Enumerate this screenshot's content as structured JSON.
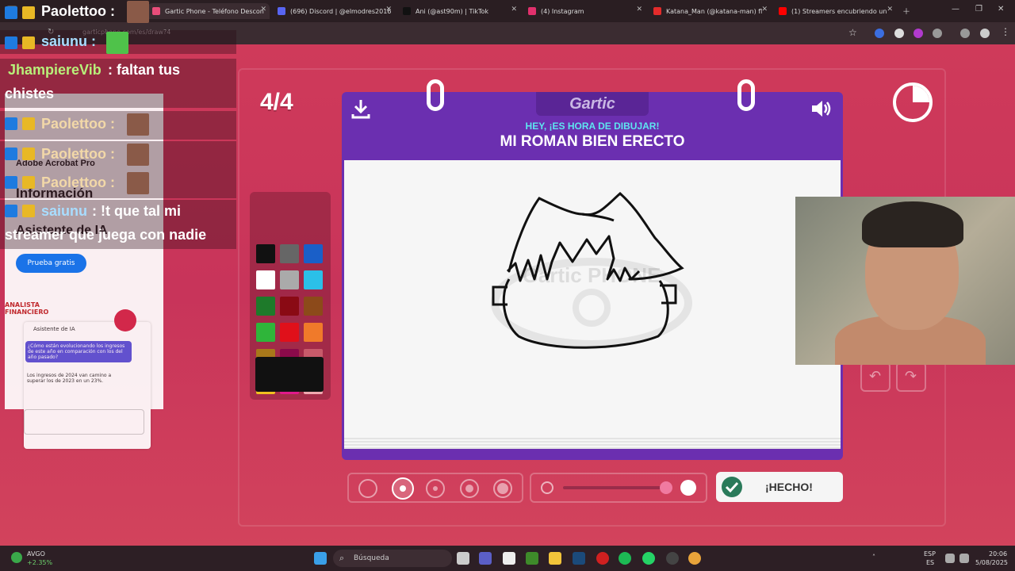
{
  "browser": {
    "tabs": [
      {
        "label": "Gartic Phone - Teléfono Descon",
        "active": true,
        "color": "#e94d7a"
      },
      {
        "label": "(696) Discord | @elmodres2016",
        "active": false,
        "color": "#5865f2"
      },
      {
        "label": "Ani (@ast90m) | TikTok",
        "active": false,
        "color": "#111111"
      },
      {
        "label": "(4) Instagram",
        "active": false,
        "color": "#e1306c"
      },
      {
        "label": "Katana_Man (@katana-man) fl",
        "active": false,
        "color": "#e32b2b"
      },
      {
        "label": "(1) Streamers encubriendo un",
        "active": false,
        "color": "#ff0000"
      }
    ],
    "url": "garticphone.com/es/draw?4"
  },
  "game": {
    "round": "4/4",
    "logo": "Gartic",
    "hey_text": "HEY, ¡ES HORA DE DIBUJAR!",
    "prompt": "MI ROMAN BIEN ERECTO",
    "done_label": "¡HECHO!",
    "palette": [
      "#111111",
      "#666666",
      "#1a5fc8",
      "#ffffff",
      "#aaaaaa",
      "#2bc0e8",
      "#1e7a2a",
      "#8a0a14",
      "#8c4a1a",
      "#2fb53a",
      "#e0101a",
      "#f07a2a",
      "#a8781a",
      "#8a0a4a",
      "#c85a6a",
      "#f0c020",
      "#e01a8a",
      "#f0a8b0"
    ],
    "current_color": "#111111",
    "canvas_watermark": "Gartic PHONE"
  },
  "chat": {
    "lines": [
      {
        "user": "Paolettoo :",
        "message": ""
      },
      {
        "user": "saiunu :",
        "message": ""
      },
      {
        "user": "JhampiereVib",
        "message": ": faltan tus"
      },
      {
        "user": "",
        "message": "chistes"
      },
      {
        "user": "Paolettoo :",
        "message": ""
      },
      {
        "user": "Paolettoo :",
        "message": ""
      },
      {
        "user": "Paolettoo :",
        "message": ""
      },
      {
        "user": "saiunu",
        "message": ": !t que tal mi"
      },
      {
        "user": "",
        "message": "streamer que juega con nadie"
      }
    ]
  },
  "acrobat": {
    "title": "Adobe Acrobat Pro",
    "heading_1": "Información",
    "heading_2": "Asistente de IA",
    "trial_button": "Prueba gratis",
    "analyst": "ANALISTA FINANCIERO",
    "assistant_title": "Asistente de IA",
    "question": "¿Cómo están evolucionando los ingresos de este año en comparación con los del año pasado?",
    "answer": "Los ingresos de 2024 van camino a superar los de 2023 en un 23%."
  },
  "taskbar": {
    "stock_name": "AVGO",
    "stock_change": "+2.35%",
    "search_label": "Búsqueda",
    "lang_1": "ESP",
    "lang_2": "ES",
    "time": "20:06",
    "date": "5/08/2025"
  }
}
